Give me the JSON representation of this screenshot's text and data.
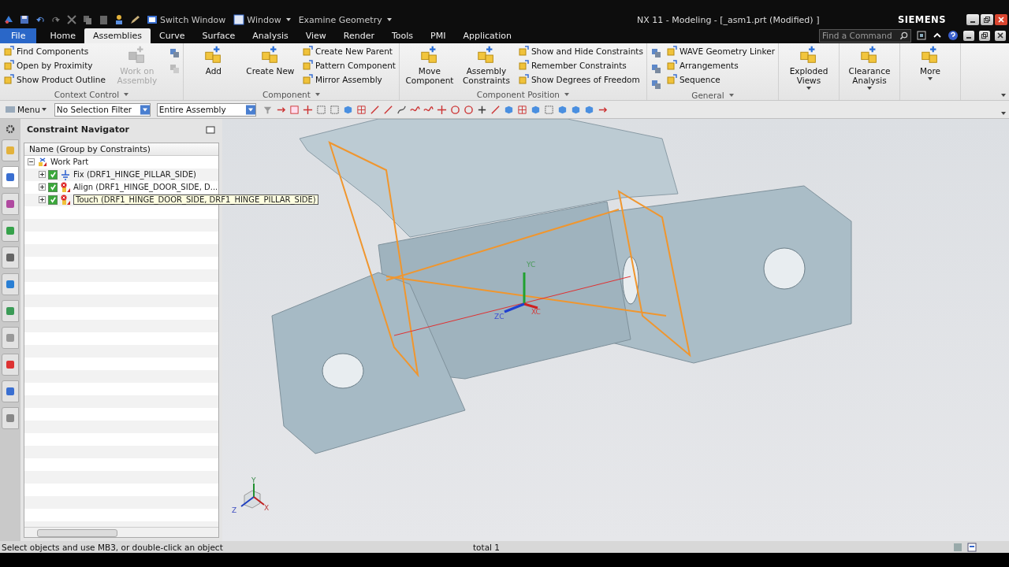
{
  "title_bar": {
    "quick_access": [
      "Switch Window",
      "Window",
      "Examine Geometry"
    ],
    "title": "NX 11 - Modeling - [_asm1.prt (Modified) ]",
    "brand": "SIEMENS"
  },
  "tabs": [
    {
      "label": "File",
      "selected": false,
      "kind": "file"
    },
    {
      "label": "Home",
      "selected": false,
      "kind": "tab"
    },
    {
      "label": "Assemblies",
      "selected": true,
      "kind": "tab"
    },
    {
      "label": "Curve",
      "selected": false,
      "kind": "tab"
    },
    {
      "label": "Surface",
      "selected": false,
      "kind": "tab"
    },
    {
      "label": "Analysis",
      "selected": false,
      "kind": "tab"
    },
    {
      "label": "View",
      "selected": false,
      "kind": "tab"
    },
    {
      "label": "Render",
      "selected": false,
      "kind": "tab"
    },
    {
      "label": "Tools",
      "selected": false,
      "kind": "tab"
    },
    {
      "label": "PMI",
      "selected": false,
      "kind": "tab"
    },
    {
      "label": "Application",
      "selected": false,
      "kind": "tab"
    }
  ],
  "command_search": {
    "placeholder": "Find a Command"
  },
  "ribbon": [
    {
      "label": "Context Control",
      "columns": [
        {
          "kind": "small",
          "items": [
            {
              "label": "Find Components",
              "disabled": false
            },
            {
              "label": "Open by Proximity",
              "disabled": false
            },
            {
              "label": "Show Product Outline",
              "disabled": false
            }
          ]
        },
        {
          "kind": "large",
          "items": [
            {
              "label": "Work on Assembly",
              "disabled": true,
              "dropdown": false
            }
          ]
        },
        {
          "kind": "icons",
          "items": [
            {
              "disabled": false
            },
            {
              "disabled": true
            }
          ]
        }
      ]
    },
    {
      "label": "Component",
      "columns": [
        {
          "kind": "large",
          "items": [
            {
              "label": "Add",
              "disabled": false,
              "dropdown": false
            },
            {
              "label": "Create New",
              "disabled": false,
              "dropdown": false
            }
          ]
        },
        {
          "kind": "small",
          "items": [
            {
              "label": "Create New Parent",
              "disabled": false
            },
            {
              "label": "Pattern Component",
              "disabled": false
            },
            {
              "label": "Mirror Assembly",
              "disabled": false
            }
          ]
        }
      ]
    },
    {
      "label": "Component Position",
      "columns": [
        {
          "kind": "large",
          "items": [
            {
              "label": "Move Component",
              "disabled": false,
              "dropdown": false
            },
            {
              "label": "Assembly Constraints",
              "disabled": false,
              "dropdown": false
            }
          ]
        },
        {
          "kind": "small",
          "items": [
            {
              "label": "Show and Hide Constraints",
              "disabled": false
            },
            {
              "label": "Remember Constraints",
              "disabled": false
            },
            {
              "label": "Show Degrees of Freedom",
              "disabled": false
            }
          ]
        }
      ]
    },
    {
      "label": "General",
      "columns": [
        {
          "kind": "icons",
          "items": [
            {
              "disabled": false
            },
            {
              "disabled": false
            },
            {
              "disabled": false
            }
          ]
        },
        {
          "kind": "small",
          "items": [
            {
              "label": "WAVE Geometry Linker",
              "disabled": false
            },
            {
              "label": "Arrangements",
              "disabled": false
            },
            {
              "label": "Sequence",
              "disabled": false
            }
          ]
        }
      ]
    },
    {
      "columns": [
        {
          "kind": "large",
          "items": [
            {
              "label": "Exploded Views",
              "disabled": false,
              "dropdown": true
            }
          ]
        }
      ]
    },
    {
      "columns": [
        {
          "kind": "large",
          "items": [
            {
              "label": "Clearance Analysis",
              "disabled": false,
              "dropdown": true
            }
          ]
        }
      ]
    },
    {
      "columns": [
        {
          "kind": "large",
          "items": [
            {
              "label": "More",
              "disabled": false,
              "dropdown": true
            }
          ]
        }
      ]
    }
  ],
  "toolbar": {
    "menu": "Menu",
    "selection_filter": "No Selection Filter",
    "scope": "Entire Assembly"
  },
  "resource_bar": [
    {
      "selected": false
    },
    {
      "selected": true
    },
    {
      "selected": false
    },
    {
      "selected": false
    },
    {
      "selected": false
    },
    {
      "selected": false
    },
    {
      "selected": false
    },
    {
      "selected": false
    },
    {
      "selected": false
    },
    {
      "selected": false
    },
    {
      "selected": false
    }
  ],
  "navigator": {
    "title": "Constraint Navigator",
    "column": "Name (Group by Constraints)",
    "tree": [
      {
        "label": "Work Part",
        "expanded": true,
        "children": [
          {
            "label": "Fix (DRF1_HINGE_PILLAR_SIDE)",
            "checked": true,
            "expanded": false,
            "hovered": false,
            "kind": "fix"
          },
          {
            "label": "Align (DRF1_HINGE_DOOR_SIDE, D...",
            "checked": true,
            "expanded": false,
            "hovered": false,
            "kind": "conflict"
          },
          {
            "label": "Touch (DRF1_HINGE_DOOR_SIDE, DRF1_HINGE_PILLAR_SIDE)",
            "checked": true,
            "expanded": false,
            "hovered": true,
            "kind": "conflict"
          }
        ]
      }
    ]
  },
  "viewport": {
    "axis_labels": [
      "YC",
      "XC",
      "ZC"
    ],
    "triad_labels": [
      "Y",
      "Z",
      "X"
    ]
  },
  "status_bar": {
    "prompt": "Select objects and use MB3, or double-click an object",
    "selection": "total 1"
  }
}
